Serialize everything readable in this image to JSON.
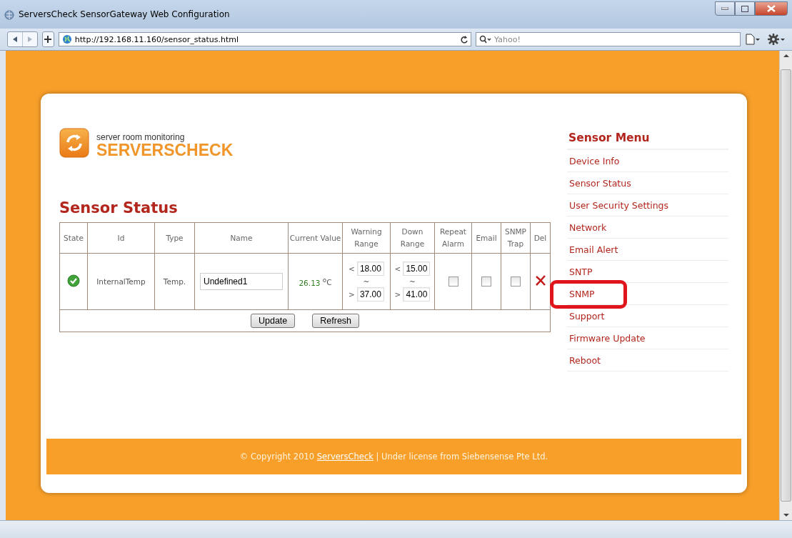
{
  "window": {
    "title": "ServersCheck SensorGateway Web Configuration"
  },
  "navbar": {
    "address": "http://192.168.11.160/sensor_status.html",
    "search_placeholder": "Yahoo!"
  },
  "logo": {
    "tagline": "server room monitoring",
    "brand": "SERVERSCHECK"
  },
  "heading": "Sensor Status",
  "table": {
    "columns": [
      "State",
      "Id",
      "Type",
      "Name",
      "Current Value",
      "Warning Range",
      "Down Range",
      "Repeat Alarm",
      "Email",
      "SNMP Trap",
      "Del"
    ],
    "rows": [
      {
        "ok": true,
        "id": "InternalTemp",
        "type": "Temp.",
        "name": "Undefined1",
        "current_value": "26.13",
        "unit": "$^{o}$C",
        "warning_range": {
          "low_sign": "<",
          "low": "18.00",
          "separator": "~",
          "high_sign": ">",
          "high": "37.00"
        },
        "down_range": {
          "low_sign": "<",
          "low": "15.00",
          "separator": "~",
          "high_sign": ">",
          "high": "41.00"
        },
        "repeat_alarm": false,
        "email": false,
        "snmp_trap": false
      }
    ],
    "buttons": [
      "Update",
      "Refresh"
    ]
  },
  "menu": {
    "title": "Sensor Menu",
    "items": [
      {
        "label": "Device Info",
        "highlighted": false
      },
      {
        "label": "Sensor Status",
        "highlighted": false
      },
      {
        "label": "User Security Settings",
        "highlighted": false
      },
      {
        "label": "Network",
        "highlighted": false
      },
      {
        "label": "Email Alert",
        "highlighted": false
      },
      {
        "label": "SNTP",
        "highlighted": false
      },
      {
        "label": "SNMP",
        "highlighted": true
      },
      {
        "label": "Support",
        "highlighted": false
      },
      {
        "label": "Firmware Update",
        "highlighted": false
      },
      {
        "label": "Reboot",
        "highlighted": false
      }
    ]
  },
  "footer": {
    "before": "© Copyright 2010 ",
    "link": "ServersCheck",
    "after": " | Under license from Siebensense Pte Ltd."
  }
}
